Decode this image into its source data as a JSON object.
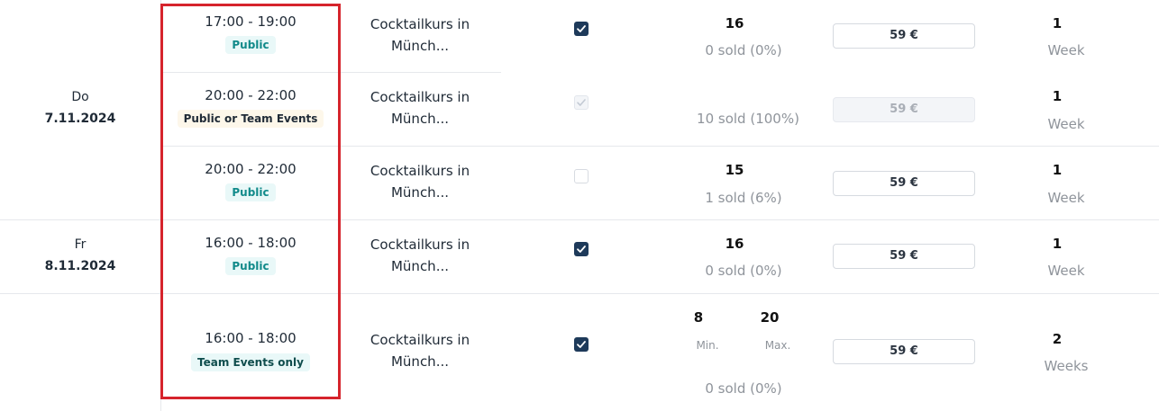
{
  "rows": [
    {
      "date_day": "",
      "date_full": "",
      "time": "17:00 - 19:00",
      "tag": "Public",
      "course": [
        "Cocktailkurs in",
        "Münch..."
      ],
      "checkbox": "checked",
      "capacity": "16",
      "sold": "0 sold (0%)",
      "price": "59 €",
      "duration_value": "1",
      "duration_unit": "Week"
    },
    {
      "date_day": "Do",
      "date_full": "7.11.2024",
      "time": "20:00 - 22:00",
      "tag": "Public or Team Events",
      "course": [
        "Cocktailkurs in",
        "Münch..."
      ],
      "checkbox": "checked-disabled",
      "capacity": "",
      "sold": "10 sold (100%)",
      "price": "59 €",
      "price_disabled": true,
      "duration_value": "1",
      "duration_unit": "Week"
    },
    {
      "date_day": "",
      "date_full": "",
      "time": "20:00 - 22:00",
      "tag": "Public",
      "course": [
        "Cocktailkurs in",
        "Münch..."
      ],
      "checkbox": "unchecked",
      "capacity": "15",
      "sold": "1 sold (6%)",
      "price": "59 €",
      "duration_value": "1",
      "duration_unit": "Week"
    },
    {
      "date_day": "Fr",
      "date_full": "8.11.2024",
      "time": "16:00 - 18:00",
      "tag": "Public",
      "course": [
        "Cocktailkurs in",
        "Münch..."
      ],
      "checkbox": "checked",
      "capacity": "16",
      "sold": "0 sold (0%)",
      "price": "59 €",
      "duration_value": "1",
      "duration_unit": "Week"
    },
    {
      "date_day": "",
      "date_full": "",
      "time": "16:00 - 18:00",
      "tag": "Team Events only",
      "course": [
        "Cocktailkurs in",
        "Münch..."
      ],
      "checkbox": "checked",
      "min_value": "8",
      "max_value": "20",
      "min_label": "Min.",
      "max_label": "Max.",
      "sold": "0 sold (0%)",
      "price": "59 €",
      "duration_value": "2",
      "duration_unit": "Weeks"
    }
  ],
  "colors": {
    "highlight": "#d6242c",
    "checkbox_checked": "#1e3a5a",
    "tag_public_text": "#118a8a",
    "tag_public_bg": "#e9f8f8",
    "muted_text": "#8f949b"
  },
  "icons": {
    "check": "check-icon"
  }
}
